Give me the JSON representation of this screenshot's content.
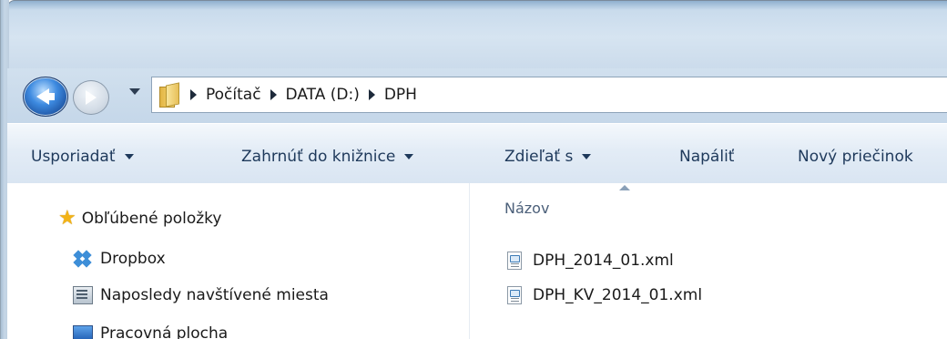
{
  "address_bar": {
    "crumbs": [
      "Počítač",
      "DATA (D:)",
      "DPH"
    ]
  },
  "toolbar": {
    "organize": "Usporiadať",
    "include_in_library": "Zahrnúť do knižnice",
    "share_with": "Zdieľať s",
    "burn": "Napáliť",
    "new_folder": "Nový priečinok"
  },
  "navigation_pane": {
    "favorites_label": "Obľúbené položky",
    "items": [
      {
        "label": "Dropbox",
        "icon": "dropbox-icon"
      },
      {
        "label": "Naposledy navštívené miesta",
        "icon": "recent-places-icon"
      },
      {
        "label": "Pracovná plocha",
        "icon": "desktop-icon"
      }
    ]
  },
  "file_list": {
    "column_name": "Názov",
    "files": [
      {
        "name": "DPH_2014_01.xml",
        "icon": "xml-file-icon"
      },
      {
        "name": "DPH_KV_2014_01.xml",
        "icon": "xml-file-icon"
      }
    ]
  },
  "colors": {
    "accent": "#1e395b",
    "title_bar": "#c9dbec"
  }
}
